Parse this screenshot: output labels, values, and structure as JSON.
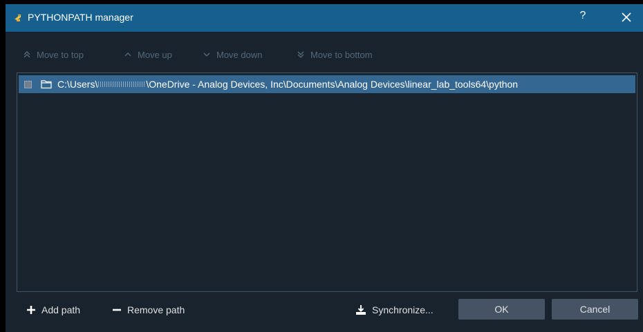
{
  "window": {
    "title": "PYTHONPATH manager",
    "help_label": "?",
    "icon": "python-logo-icon"
  },
  "toolbar": {
    "move_top": "Move to top",
    "move_up": "Move up",
    "move_down": "Move down",
    "move_bottom": "Move to bottom"
  },
  "paths": [
    {
      "checked": false,
      "prefix": "C:\\Users\\",
      "suffix": "\\OneDrive - Analog Devices, Inc\\Documents\\Analog Devices\\linear_lab_tools64\\python"
    }
  ],
  "actions": {
    "add_path": "Add path",
    "remove_path": "Remove path",
    "synchronize": "Synchronize...",
    "ok": "OK",
    "cancel": "Cancel"
  },
  "colors": {
    "titlebar": "#16608f",
    "background": "#19232d",
    "selection": "#346792",
    "button": "#455364",
    "disabled_text": "#54687a"
  }
}
